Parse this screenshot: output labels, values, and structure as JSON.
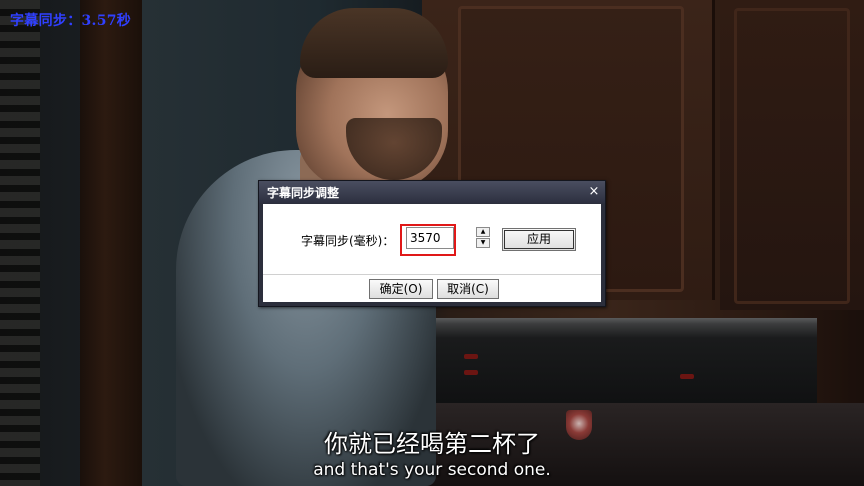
{
  "osd": {
    "text": "字幕同步：3.57秒",
    "color": "#3040ff"
  },
  "subtitles": {
    "chinese": "你就已经喝第二杯了",
    "english": "and that's your second one."
  },
  "dialog": {
    "title": "字幕同步调整",
    "close_symbol": "×",
    "sync_label": "字幕同步(毫秒)：",
    "sync_value": "3570",
    "spin_up_symbol": "▲",
    "spin_down_symbol": "▼",
    "apply_label": "应用",
    "ok_label": "确定(O)",
    "cancel_label": "取消(C)",
    "highlight_color": "#e01818"
  }
}
